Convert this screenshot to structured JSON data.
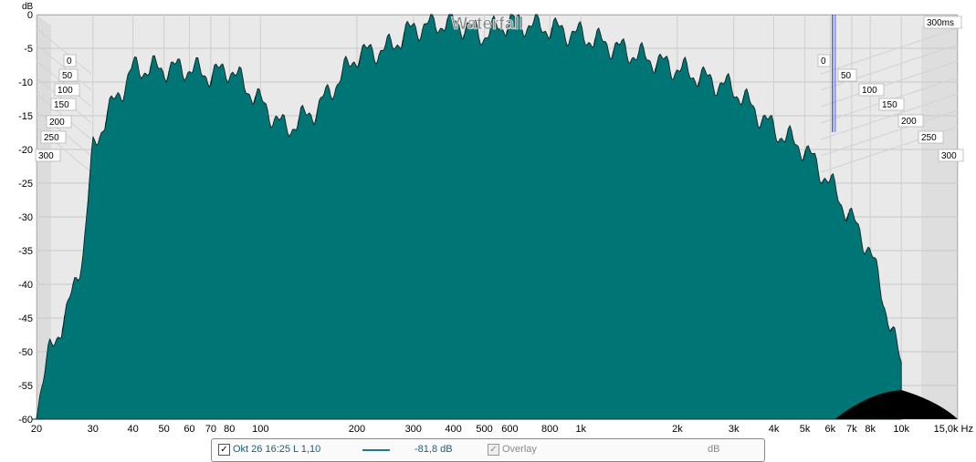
{
  "chart_data": {
    "type": "area",
    "title": "Waterfall",
    "x_unit": "Hz",
    "y_unit": "dB",
    "x_scale": "log",
    "xlim": [
      20,
      15000
    ],
    "ylim": [
      -60,
      0
    ],
    "x_ticks": [
      {
        "v": 20,
        "label": "20"
      },
      {
        "v": 30,
        "label": "30"
      },
      {
        "v": 40,
        "label": "40"
      },
      {
        "v": 50,
        "label": "50"
      },
      {
        "v": 60,
        "label": "60"
      },
      {
        "v": 70,
        "label": "70"
      },
      {
        "v": 80,
        "label": "80"
      },
      {
        "v": 100,
        "label": "100"
      },
      {
        "v": 200,
        "label": "200"
      },
      {
        "v": 300,
        "label": "300"
      },
      {
        "v": 400,
        "label": "400"
      },
      {
        "v": 500,
        "label": "500"
      },
      {
        "v": 600,
        "label": "600"
      },
      {
        "v": 800,
        "label": "800"
      },
      {
        "v": 1000,
        "label": "1k"
      },
      {
        "v": 2000,
        "label": "2k"
      },
      {
        "v": 3000,
        "label": "3k"
      },
      {
        "v": 4000,
        "label": "4k"
      },
      {
        "v": 5000,
        "label": "5k"
      },
      {
        "v": 6000,
        "label": "6k"
      },
      {
        "v": 7000,
        "label": "7k"
      },
      {
        "v": 8000,
        "label": "8k"
      },
      {
        "v": 10000,
        "label": "10k"
      },
      {
        "v": 15000,
        "label": "15,0k Hz"
      }
    ],
    "y_ticks": [
      0,
      -5,
      -10,
      -15,
      -20,
      -25,
      -30,
      -35,
      -40,
      -45,
      -50,
      -55,
      -60
    ],
    "time_axis_unit": "ms",
    "time_range_label": "300ms",
    "time_ticks_left": [
      "0",
      "50",
      "100",
      "150",
      "200",
      "250",
      "300"
    ],
    "time_ticks_right": [
      "0",
      "50",
      "100",
      "150",
      "200",
      "250",
      "300"
    ],
    "front_slice_envelope": {
      "x": [
        20,
        22,
        25,
        28,
        30,
        33,
        36,
        40,
        45,
        50,
        60,
        70,
        80,
        100,
        120,
        150,
        200,
        250,
        300,
        400,
        500,
        600,
        800,
        1000,
        1500,
        2000,
        3000,
        4000,
        5000,
        6000,
        8000,
        10000
      ],
      "y": [
        -58,
        -50,
        -44,
        -35,
        -20,
        -15,
        -12,
        -8,
        -8,
        -8,
        -8,
        -9,
        -8,
        -13,
        -17,
        -14,
        -6,
        -5,
        -2,
        -1,
        -3,
        -1,
        -2,
        -3,
        -6,
        -8,
        -11,
        -17,
        -20,
        -25,
        -35,
        -52
      ]
    },
    "fill_color": "#007575",
    "line_color": "#0b2626"
  },
  "legend": {
    "entry_label": "Okt 26 16:25 L 1,10",
    "value": "-81,8 dB",
    "overlay_label": "Overlay",
    "unit_label": "dB",
    "entry_checked": true,
    "overlay_checked": true,
    "line_color": "#1f7a8a"
  }
}
